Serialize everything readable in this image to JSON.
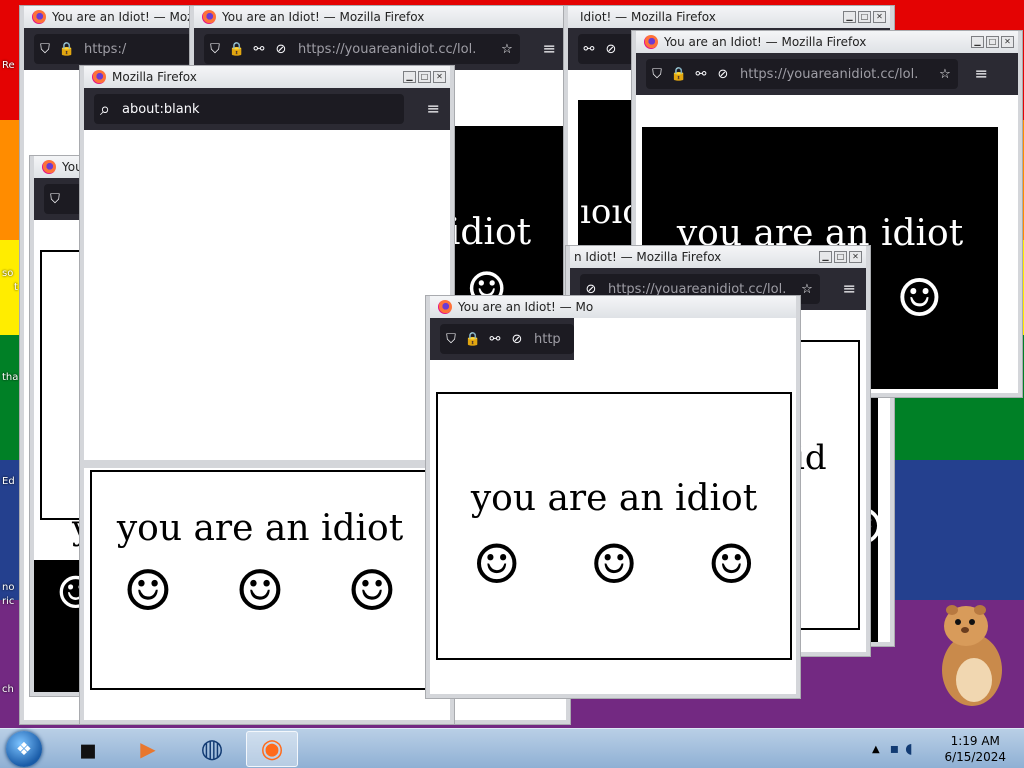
{
  "colors": {
    "firefox_nav": "#2b2a33",
    "firefox_urlbar": "#1c1b22",
    "titlebar": "#e6e8eb",
    "taskbar": "#a5c0dd"
  },
  "desktop_labels": [
    "Re",
    "so",
    "t",
    "tha",
    "Ed",
    "no",
    "ric",
    "ch"
  ],
  "windows": {
    "title_idiot": "You are an Idiot! — Mozilla Firefox",
    "title_idiot_trunc": "You are an Idiot! — Mozilla",
    "title_idiot_trunc2": "You are an Idiot! — Mo",
    "title_idiot_tail": "Idiot! — Mozilla Firefox",
    "title_idiot_tail2": "n Idiot! — Mozilla Firefox",
    "title_you": "You",
    "title_blank": "Mozilla Firefox",
    "url_idiot": "https://youareanidiot.cc/lol.",
    "url_short": "https:/",
    "url_http": "http",
    "url_blank": "about:blank"
  },
  "page": {
    "phrase": "you are an idiot",
    "phrase_part_ot": "idiot",
    "phrase_part_you": "you",
    "phrase_part_oi": "ıoıo",
    "phrase_part_id": "id",
    "phrase_y": "y",
    "smiley": "☺"
  },
  "icons": {
    "shield": "⛉",
    "lock": "🔒",
    "permissions": "⚯",
    "tracking": "⊘",
    "star": "☆",
    "menu": "≡",
    "search": "⌕",
    "minimize": "▁",
    "maximize": "□",
    "close": "✕",
    "start": "❖",
    "firefox": "◉",
    "media": "▶",
    "terminal": "▪",
    "globe": "◍",
    "volume": "◖"
  },
  "taskbar": {
    "time": "1:19 AM",
    "date": "6/15/2024"
  }
}
